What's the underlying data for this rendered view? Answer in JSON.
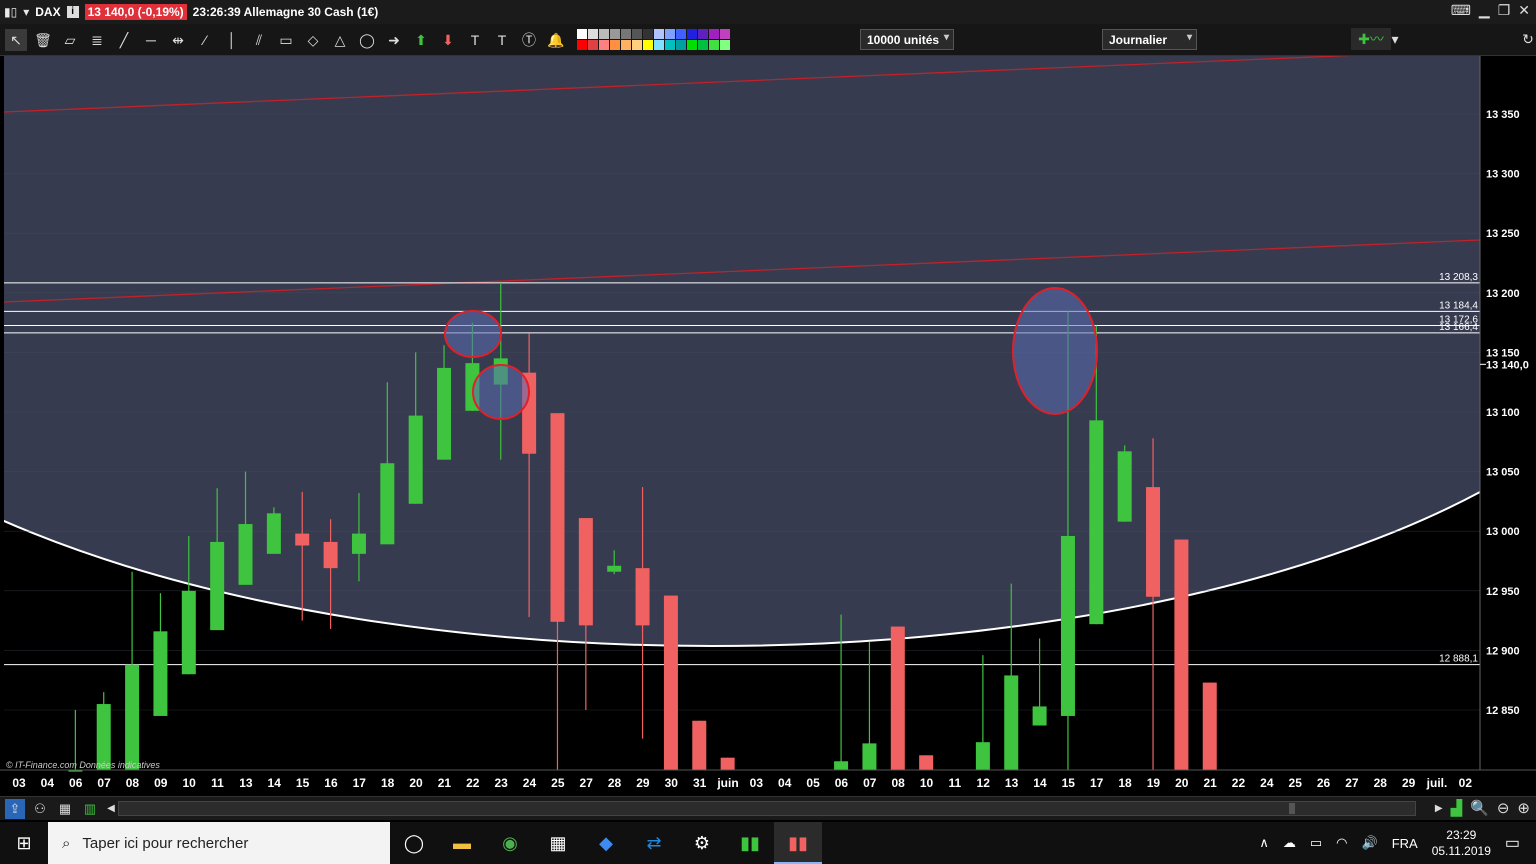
{
  "window": {
    "symbol": "DAX",
    "price_badge": "13 140,0 (-0,19%)",
    "title": "23:26:39 Allemagne 30 Cash (1€)"
  },
  "toolbar": {
    "units_select": "10000 unités",
    "period_select": "Journalier"
  },
  "chart_data": {
    "type": "candlestick",
    "x_labels": [
      "03",
      "04",
      "06",
      "07",
      "08",
      "09",
      "10",
      "11",
      "13",
      "14",
      "15",
      "16",
      "17",
      "18",
      "20",
      "21",
      "22",
      "23",
      "24",
      "25",
      "27",
      "28",
      "29",
      "30",
      "31",
      "juin",
      "03",
      "04",
      "05",
      "06",
      "07",
      "08",
      "10",
      "11",
      "12",
      "13",
      "14",
      "15",
      "17",
      "18",
      "19",
      "20",
      "21",
      "22",
      "24",
      "25",
      "26",
      "27",
      "28",
      "29",
      "juil.",
      "02"
    ],
    "candles": [
      {
        "x": "04",
        "o": 12800,
        "h": 12850,
        "l": 12800,
        "c": 12800
      },
      {
        "x": "06",
        "o": 12800,
        "h": 12865,
        "l": 12800,
        "c": 12855
      },
      {
        "x": "07",
        "o": 12800,
        "h": 12966,
        "l": 12800,
        "c": 12888
      },
      {
        "x": "08",
        "o": 12845,
        "h": 12948,
        "l": 12845,
        "c": 12916
      },
      {
        "x": "09",
        "o": 12880,
        "h": 12996,
        "l": 12880,
        "c": 12950
      },
      {
        "x": "10",
        "o": 12917,
        "h": 13036,
        "l": 12917,
        "c": 12991
      },
      {
        "x": "11",
        "o": 12955,
        "h": 13050,
        "l": 12955,
        "c": 13006
      },
      {
        "x": "13",
        "o": 12981,
        "h": 13020,
        "l": 12981,
        "c": 13015
      },
      {
        "x": "14",
        "o": 12998,
        "h": 13033,
        "l": 12925,
        "c": 12988
      },
      {
        "x": "15",
        "o": 12991,
        "h": 13010,
        "l": 12918,
        "c": 12969
      },
      {
        "x": "16",
        "o": 12981,
        "h": 13032,
        "l": 12958,
        "c": 12998
      },
      {
        "x": "17",
        "o": 12989,
        "h": 13125,
        "l": 12989,
        "c": 13057
      },
      {
        "x": "18",
        "o": 13023,
        "h": 13150,
        "l": 13023,
        "c": 13097
      },
      {
        "x": "20",
        "o": 13060,
        "h": 13156,
        "l": 13060,
        "c": 13137
      },
      {
        "x": "21",
        "o": 13101,
        "h": 13175,
        "l": 13101,
        "c": 13141
      },
      {
        "x": "22",
        "o": 13123,
        "h": 13208.3,
        "l": 13060,
        "c": 13145
      },
      {
        "x": "23",
        "o": 13133,
        "h": 13166,
        "l": 12928,
        "c": 13065
      },
      {
        "x": "24",
        "o": 13099,
        "h": 13099,
        "l": 12800,
        "c": 12924
      },
      {
        "x": "25",
        "o": 13011,
        "h": 13011,
        "l": 12850,
        "c": 12921
      },
      {
        "x": "27",
        "o": 12966,
        "h": 12984,
        "l": 12964,
        "c": 12971
      },
      {
        "x": "28",
        "o": 12969,
        "h": 13037,
        "l": 12826,
        "c": 12921
      },
      {
        "x": "29",
        "o": 12946,
        "h": 12946,
        "l": 12800,
        "c": 12800
      },
      {
        "x": "30",
        "o": 12841,
        "h": 12841,
        "l": 12800,
        "c": 12800
      },
      {
        "x": "31",
        "o": 12810,
        "h": 12810,
        "l": 12800,
        "c": 12800
      },
      {
        "x": "05",
        "o": 12800,
        "h": 12930,
        "l": 12800,
        "c": 12807
      },
      {
        "x": "06",
        "o": 12800,
        "h": 12907,
        "l": 12800,
        "c": 12822
      },
      {
        "x": "07",
        "o": 12920,
        "h": 12920,
        "l": 12800,
        "c": 12800
      },
      {
        "x": "08",
        "o": 12812,
        "h": 12812,
        "l": 12800,
        "c": 12800
      },
      {
        "x": "11",
        "o": 12800,
        "h": 12896,
        "l": 12800,
        "c": 12823
      },
      {
        "x": "12",
        "o": 12800,
        "h": 12956,
        "l": 12800,
        "c": 12879
      },
      {
        "x": "13",
        "o": 12837,
        "h": 12910,
        "l": 12837,
        "c": 12853
      },
      {
        "x": "14",
        "o": 12845,
        "h": 13184.4,
        "l": 12800,
        "c": 12996
      },
      {
        "x": "15",
        "o": 12922,
        "h": 13172.6,
        "l": 12922,
        "c": 13093
      },
      {
        "x": "17",
        "o": 13008,
        "h": 13072,
        "l": 13008,
        "c": 13067
      },
      {
        "x": "18",
        "o": 13037,
        "h": 13078,
        "l": 12800,
        "c": 12945
      },
      {
        "x": "19",
        "o": 12993,
        "h": 12993,
        "l": 12800,
        "c": 12800
      },
      {
        "x": "20",
        "o": 12873,
        "h": 12873,
        "l": 12800,
        "c": 12800
      }
    ],
    "y_ticks": [
      "13 350",
      "13 300",
      "13 250",
      "13 200",
      "13 150",
      "13 100",
      "13 050",
      "13 000",
      "12 950",
      "12 900",
      "12 850"
    ],
    "horizontal_levels": [
      {
        "value": 13208.3,
        "label": "13 208,3"
      },
      {
        "value": 13184.4,
        "label": "13 184,4"
      },
      {
        "value": 13172.6,
        "label": "13 172,6"
      },
      {
        "value": 13166.4,
        "label": "13 166,4"
      },
      {
        "value": 12888.1,
        "label": "12 888,1"
      }
    ],
    "current_price": {
      "value": 13140.0,
      "label": "13 140,0"
    },
    "ylim": [
      12800,
      13400
    ],
    "colors": {
      "up": "#3ec43e",
      "down": "#f06262",
      "background": "#000000",
      "ellipse_fill": "#363b4f",
      "ellipse_stroke": "#ffffff",
      "trendline": "#c0222a"
    },
    "watermark": "© IT-Finance.com Données indicatives"
  },
  "taskbar": {
    "search_placeholder": "Taper ici pour rechercher",
    "language": "FRA",
    "time": "23:29",
    "date": "05.11.2019"
  }
}
